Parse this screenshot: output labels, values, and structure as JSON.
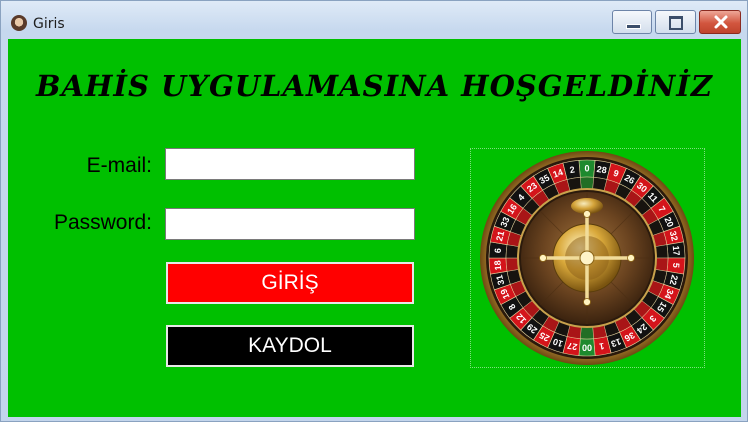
{
  "window": {
    "title": "Giris",
    "icon": "user-avatar-icon",
    "controls": [
      "minimize-icon",
      "maximize-icon",
      "close-icon"
    ]
  },
  "form": {
    "heading": "BAHİS UYGULAMASINA HOŞGELDİNİZ",
    "email_label": "E-mail:",
    "email_value": "",
    "password_label": "Password:",
    "password_value": "",
    "login_button": "GİRİŞ",
    "register_button": "KAYDOL"
  },
  "image": {
    "name": "roulette-wheel",
    "numbers": [
      "0",
      "28",
      "9",
      "26",
      "30",
      "11",
      "7",
      "20",
      "32",
      "17",
      "5",
      "22",
      "34",
      "15",
      "3",
      "24",
      "36",
      "13",
      "1",
      "00",
      "27",
      "10",
      "25",
      "29",
      "12",
      "8",
      "19",
      "31",
      "18",
      "6",
      "21",
      "33",
      "16",
      "4",
      "23",
      "35",
      "14",
      "2"
    ]
  },
  "colors": {
    "background": "#00c000",
    "login_button": "#ff0000",
    "register_button": "#000000",
    "button_text": "#ffffff"
  }
}
